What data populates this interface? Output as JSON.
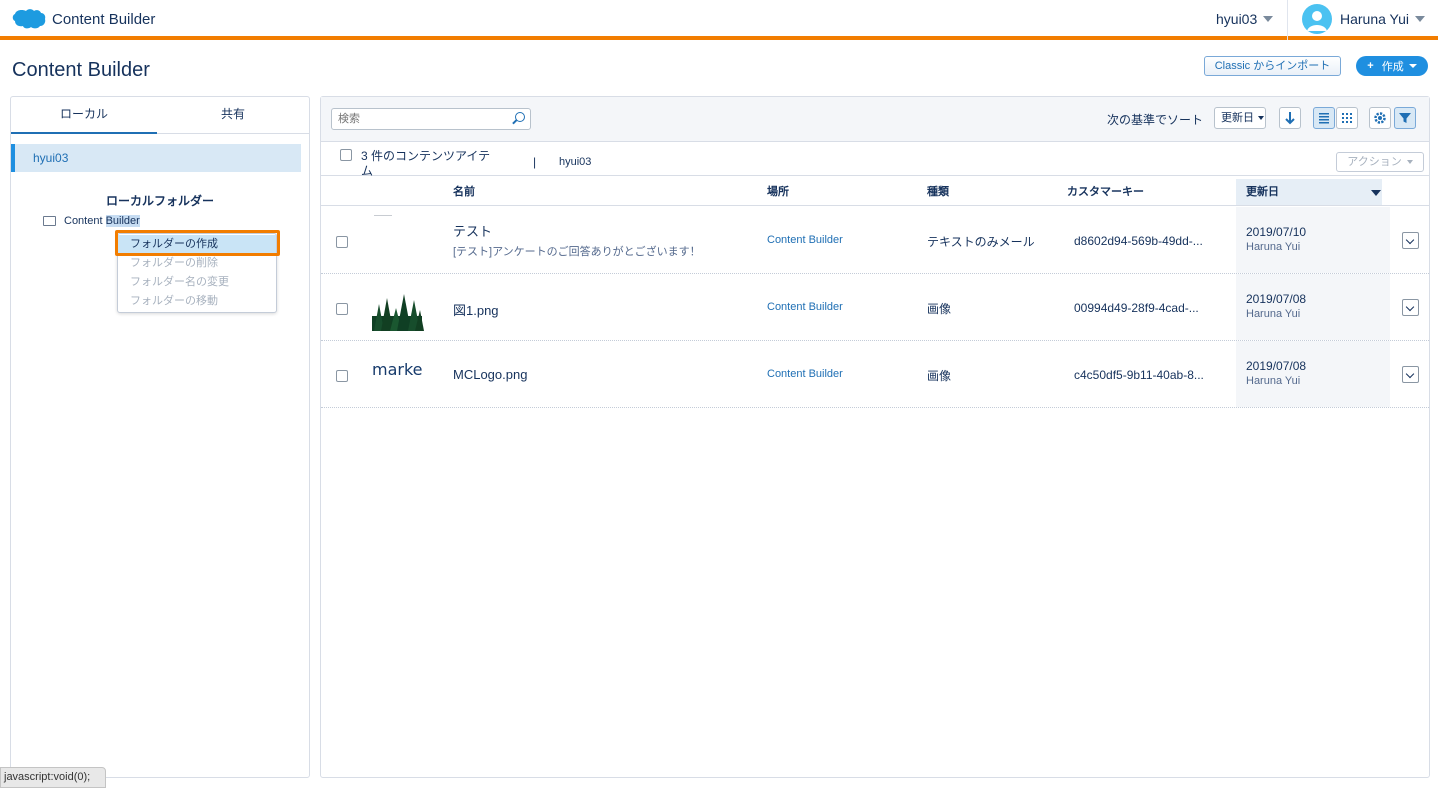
{
  "app": {
    "title": "Content Builder",
    "user_switch": "hyui03",
    "profile_name": "Haruna Yui"
  },
  "page": {
    "title": "Content Builder",
    "import_label": "Classic からインポート",
    "create_label": "作成"
  },
  "left": {
    "tabs": [
      {
        "label": "ローカル"
      },
      {
        "label": "共有"
      }
    ],
    "user_folder": "hyui03",
    "heading": "ローカルフォルダー",
    "tree_item_prefix": "Content ",
    "tree_item_selected": "Builder",
    "context_menu": [
      "フォルダーの作成",
      "フォルダーの削除",
      "フォルダー名の変更",
      "フォルダーの移動"
    ]
  },
  "toolbar": {
    "search_placeholder": "検索",
    "sort_label": "次の基準でソート",
    "sort_value": "更新日"
  },
  "selection": {
    "count_text": "3 件のコンテンツアイテム",
    "pipe": "|",
    "breadcrumb": "hyui03",
    "action_label": "アクション"
  },
  "columns": [
    "名前",
    "場所",
    "種類",
    "カスタマーキー",
    "更新日"
  ],
  "rows": [
    {
      "name": "テスト",
      "subtitle": "[テスト]アンケートのご回答ありがとございます！",
      "location": "Content Builder",
      "type": "テキストのみメール",
      "key": "d8602d94-569b-49dd-...",
      "date": "2019/07/10",
      "user": "Haruna Yui",
      "thumb": "none"
    },
    {
      "name": "図1.png",
      "subtitle": "",
      "location": "Content Builder",
      "type": "画像",
      "key": "00994d49-28f9-4cad-...",
      "date": "2019/07/08",
      "user": "Haruna Yui",
      "thumb": "trees"
    },
    {
      "name": "MCLogo.png",
      "subtitle": "",
      "location": "Content Builder",
      "type": "画像",
      "key": "c4c50df5-9b11-40ab-8...",
      "date": "2019/07/08",
      "user": "Haruna Yui",
      "thumb": "marke",
      "thumb_text": "marke"
    }
  ],
  "status_tip": "javascript:void(0);",
  "colors": {
    "accent": "#f27d00",
    "brand_blue": "#1f8fe0",
    "link": "#1f6fb4"
  }
}
